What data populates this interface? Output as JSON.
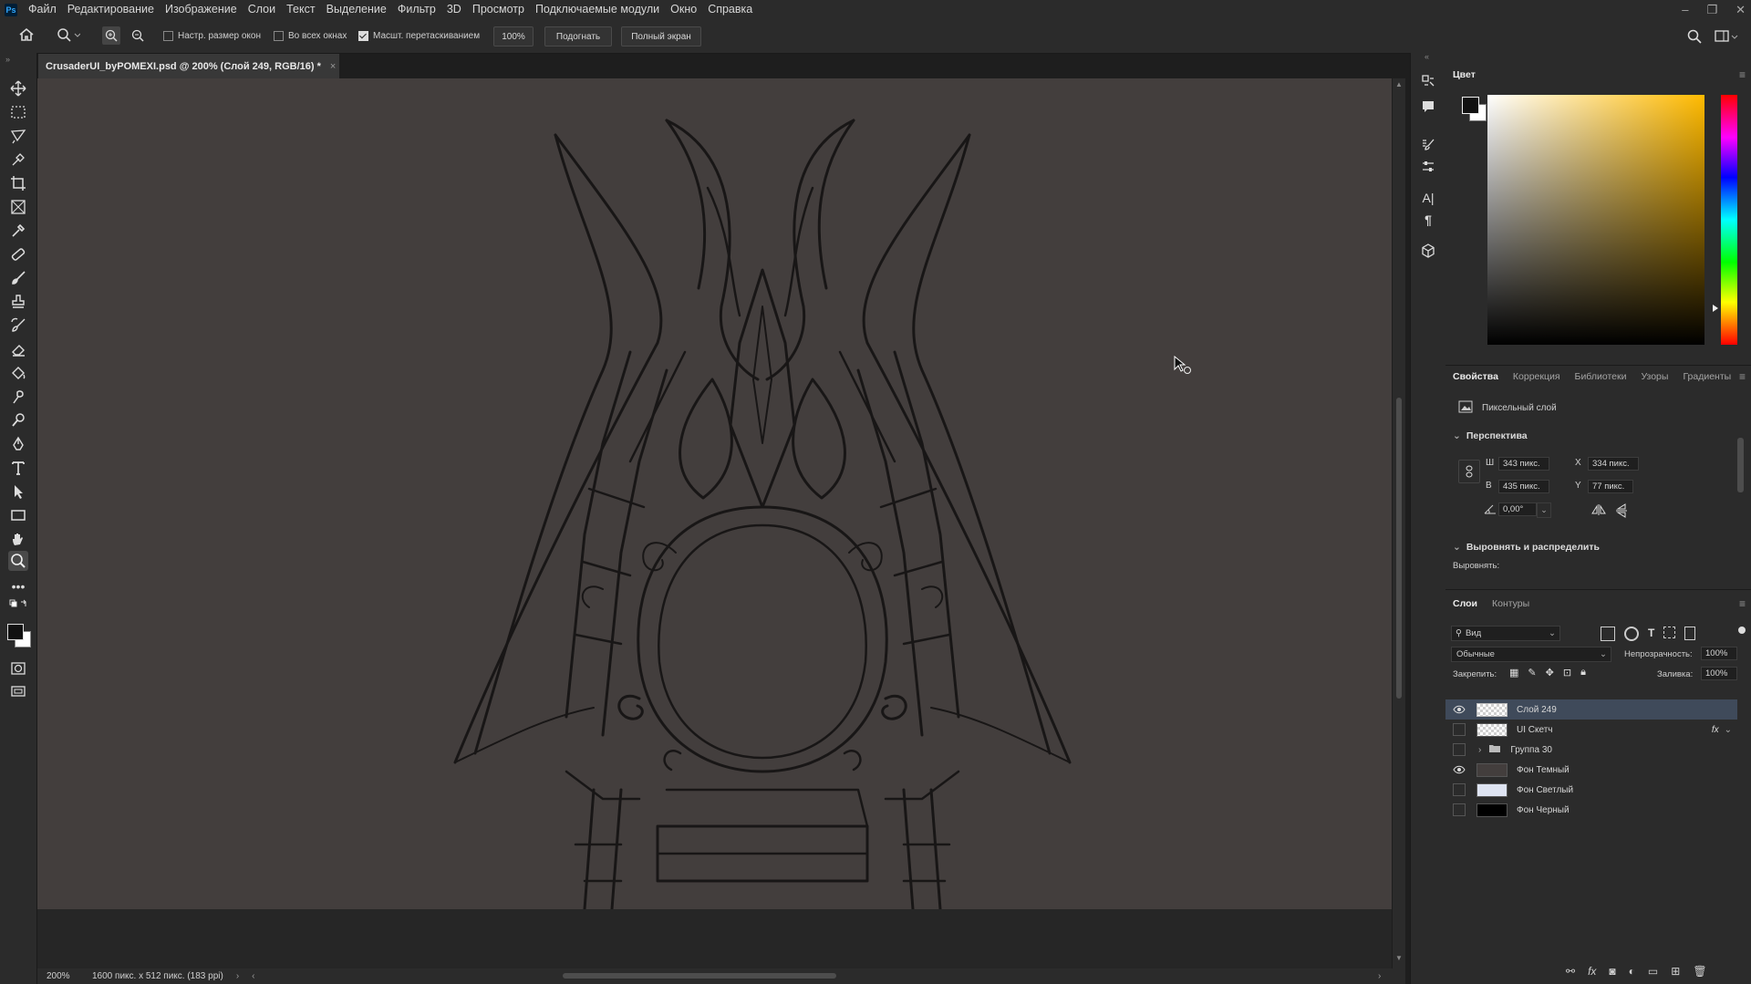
{
  "menu": {
    "logo": "Ps",
    "items": [
      "Файл",
      "Редактирование",
      "Изображение",
      "Слои",
      "Текст",
      "Выделение",
      "Фильтр",
      "3D",
      "Просмотр",
      "Подключаемые модули",
      "Окно",
      "Справка"
    ]
  },
  "options": {
    "resize_windows": "Настр. размер окон",
    "all_windows": "Во всех окнах",
    "scrubby_zoom": "Масшт. перетаскиванием",
    "zoom_value": "100%",
    "fit_button": "Подогнать",
    "fullscreen_button": "Полный экран"
  },
  "document": {
    "tab_title": "CrusaderUI_byPOMEXI.psd @ 200% (Слой 249, RGB/16) *"
  },
  "status": {
    "zoom": "200%",
    "doc_info": "1600 пикс. x 512 пикс. (183 ppi)"
  },
  "color_panel": {
    "title": "Цвет",
    "foreground": "#111111",
    "background": "#ffffff",
    "hue_color": "#ffba00"
  },
  "properties": {
    "tabs": [
      "Свойства",
      "Коррекция",
      "Библиотеки",
      "Узоры",
      "Градиенты"
    ],
    "layer_kind": "Пиксельный слой",
    "transform_section": "Перспектива",
    "w_label": "Ш",
    "w_value": "343 пикс.",
    "h_label": "В",
    "h_value": "435 пикс.",
    "x_label": "X",
    "x_value": "334 пикс.",
    "y_label": "Y",
    "y_value": "77 пикс.",
    "angle_value": "0,00°",
    "align_section": "Выровнять и распределить",
    "align_label": "Выровнять:"
  },
  "layers_panel": {
    "tabs": [
      "Слои",
      "Контуры"
    ],
    "filter_label": "Вид",
    "blend_mode": "Обычные",
    "opacity_label": "Непрозрачность:",
    "opacity_value": "100%",
    "lock_label": "Закрепить:",
    "fill_label": "Заливка:",
    "fill_value": "100%",
    "fx_label": "fx",
    "layers": [
      {
        "name": "Слой 249",
        "visible": true,
        "selected": true,
        "thumb": "checker"
      },
      {
        "name": "UI Скетч",
        "visible": false,
        "selected": false,
        "thumb": "checker",
        "fx": true
      },
      {
        "name": "Группа 30",
        "visible": false,
        "selected": false,
        "thumb": "folder"
      },
      {
        "name": "Фон Темный",
        "visible": true,
        "selected": false,
        "thumb": "#433e3d"
      },
      {
        "name": "Фон Светлый",
        "visible": false,
        "selected": false,
        "thumb": "#dfe4f2"
      },
      {
        "name": "Фон Черный",
        "visible": false,
        "selected": false,
        "thumb": "#000000"
      }
    ]
  }
}
